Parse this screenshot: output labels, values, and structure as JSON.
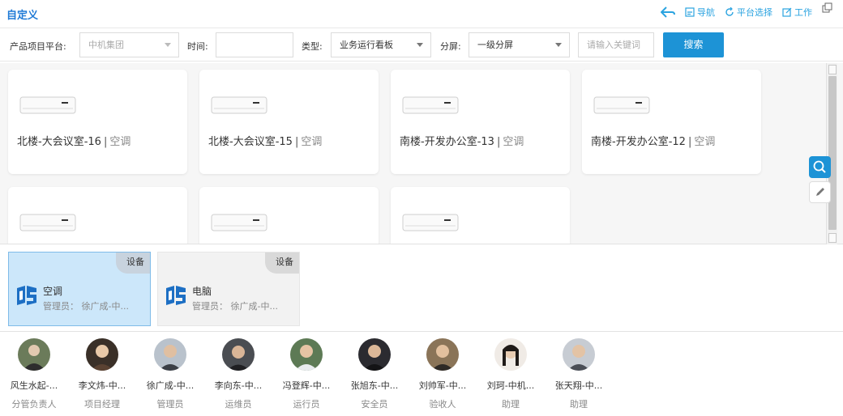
{
  "header": {
    "title": "自定义",
    "actions": [
      {
        "label": "",
        "icon": "back-icon"
      },
      {
        "label": "导航",
        "icon": "nav-icon"
      },
      {
        "label": "平台选择",
        "icon": "refresh-icon"
      },
      {
        "label": "工作",
        "icon": "edit-icon"
      }
    ]
  },
  "filters": {
    "platform_label": "产品项目平台:",
    "platform_value": "中机集团",
    "time_label": "时间:",
    "time_value": "",
    "type_label": "类型:",
    "type_value": "业务运行看板",
    "screen_label": "分屏:",
    "screen_value": "一级分屏",
    "keyword_placeholder": "请输入关键词",
    "search_label": "搜索"
  },
  "cards": [
    {
      "location": "北楼-大会议室-16",
      "type": "空调"
    },
    {
      "location": "北楼-大会议室-15",
      "type": "空调"
    },
    {
      "location": "南楼-开发办公室-13",
      "type": "空调"
    },
    {
      "location": "南楼-开发办公室-12",
      "type": "空调"
    },
    {
      "location": "",
      "type": ""
    },
    {
      "location": "",
      "type": ""
    },
    {
      "location": "",
      "type": ""
    }
  ],
  "card_separator": "|",
  "devices": [
    {
      "tag": "设备",
      "name": "空调",
      "manager": "管理员： 徐广成-中...",
      "selected": true
    },
    {
      "tag": "设备",
      "name": "电脑",
      "manager": "管理员： 徐广成-中...",
      "selected": false
    }
  ],
  "people": [
    {
      "name": "风生水起-...",
      "role": "分管负责人",
      "avatar_color": "#6b7b5a"
    },
    {
      "name": "李文炜-中...",
      "role": "项目经理",
      "avatar_color": "#3a3028"
    },
    {
      "name": "徐广成-中...",
      "role": "管理员",
      "avatar_color": "#5a6470"
    },
    {
      "name": "李向东-中...",
      "role": "运维员",
      "avatar_color": "#3b3d40"
    },
    {
      "name": "冯登辉-中...",
      "role": "运行员",
      "avatar_color": "#4f6a4b"
    },
    {
      "name": "张旭东-中...",
      "role": "安全员",
      "avatar_color": "#2b2b30"
    },
    {
      "name": "刘帅军-中...",
      "role": "验收人",
      "avatar_color": "#6e5a44"
    },
    {
      "name": "刘珂-中机...",
      "role": "助理",
      "avatar_color": "#2c2420"
    },
    {
      "name": "张天翔-中...",
      "role": "助理",
      "avatar_color": "#8a8e96"
    }
  ],
  "colors": {
    "accent": "#1d93d6",
    "title": "#1f7ad6",
    "selected_bg": "#cce7fa"
  }
}
